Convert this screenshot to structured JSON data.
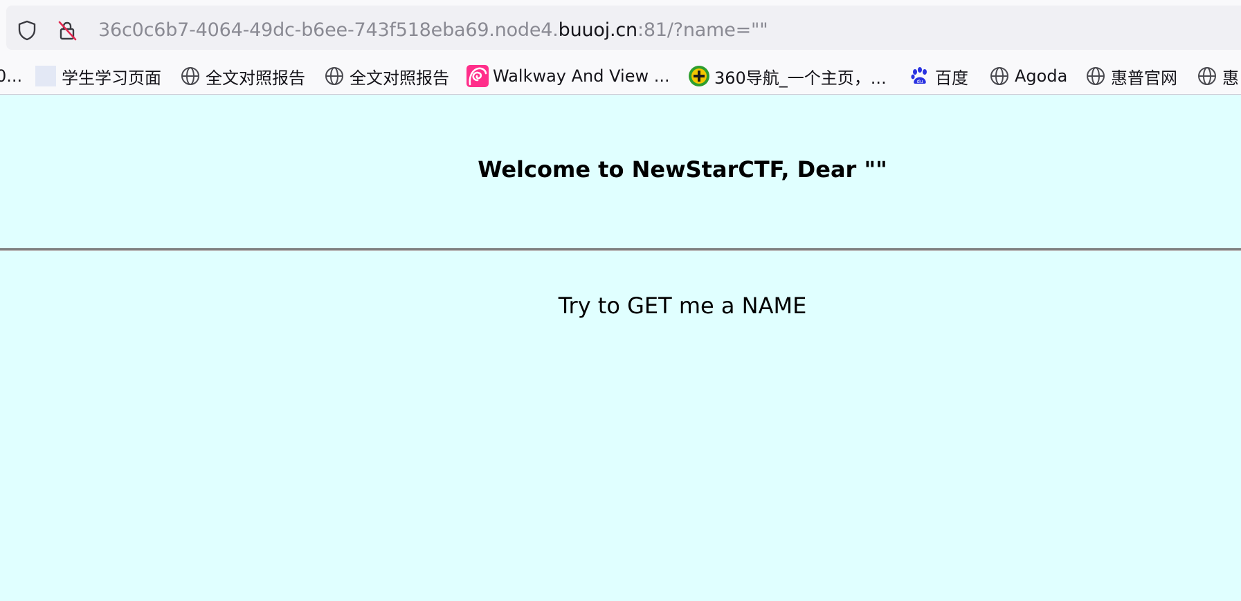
{
  "browser": {
    "url": {
      "prefix": "36c0c6b7-4064-49dc-b6ee-743f518eba69.node4.",
      "domain": "buuoj.cn",
      "suffix": ":81/?name=\"\""
    },
    "icons": {
      "tracking_protection": "shield-icon",
      "connection_status": "insecure-lock-icon"
    },
    "bookmarks": [
      {
        "label": "0...",
        "icon": "none"
      },
      {
        "label": "学生学习页面",
        "icon": "blank-page-icon"
      },
      {
        "label": "全文对照报告",
        "icon": "globe-icon"
      },
      {
        "label": "全文对照报告",
        "icon": "globe-icon"
      },
      {
        "label": "Walkway And View ...",
        "icon": "spiral-logo-icon"
      },
      {
        "label": "360导航_一个主页，...",
        "icon": "360-logo-icon"
      },
      {
        "label": "百度",
        "icon": "baidu-paw-icon"
      },
      {
        "label": "Agoda",
        "icon": "globe-icon"
      },
      {
        "label": "惠普官网",
        "icon": "globe-icon"
      },
      {
        "label": "惠",
        "icon": "globe-icon"
      }
    ]
  },
  "page": {
    "title": "Welcome to NewStarCTF, Dear \"\"",
    "message": "Try to GET me a NAME",
    "background_color": "#e0ffff"
  }
}
